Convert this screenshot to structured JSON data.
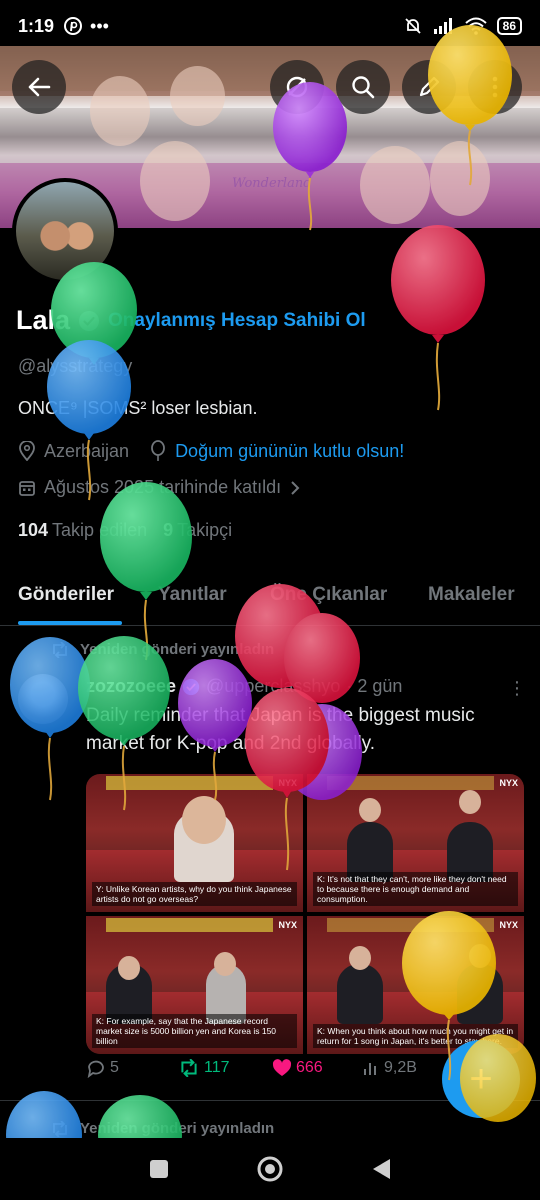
{
  "status_bar": {
    "time": "1:19",
    "battery": "86",
    "icons": [
      "pinterest-icon",
      "more-dots-icon",
      "mute-icon",
      "signal-icon",
      "wifi-icon",
      "battery-icon"
    ]
  },
  "header": {
    "banner_text": "Wonderland",
    "buttons": [
      "back-arrow-icon",
      "slash-eye-icon",
      "search-icon",
      "edit-icon",
      "more-vertical-icon"
    ]
  },
  "profile": {
    "name": "Lala",
    "verify_link": "Onaylanmış Hesap Sahibi Ol",
    "handle": "@alysstrategy",
    "bio": "ONCE⁹ |SOMS²  loser lesbian.",
    "location": "Azerbaijan",
    "birthday": "Doğum gününün kutlu olsun!",
    "joined": "Ağustos 2025 tarihinde katıldı",
    "following_count": "104",
    "following_label": "Takip edilen",
    "followers_count": "9",
    "followers_label": "Takipçi"
  },
  "tabs": [
    {
      "label": "Gönderiler",
      "active": true
    },
    {
      "label": "Yanıtlar",
      "active": false
    },
    {
      "label": "Öne Çıkanlar",
      "active": false
    },
    {
      "label": "Makaleler",
      "active": false
    }
  ],
  "tweet": {
    "repost_label": "Yeniden gönderi yayınladın",
    "author_name": "zozozoeee",
    "author_handle": "@upperclasshyo",
    "time": "· 2 gün",
    "text": "Daily reminder that Japan is the biggest music market for K-pop and 2nd globally.",
    "media": [
      {
        "caption": "Y: Unlike Korean artists, why do you think Japanese artists do not go overseas?",
        "badge": "NYX"
      },
      {
        "caption": "K: It's not that they can't, more like they don't need to because there is enough demand and consumption.",
        "badge": "NYX"
      },
      {
        "caption": "K: For example, say that the Japanese record market size is 5000 billion yen and Korea is 150 billion",
        "badge": "NYX"
      },
      {
        "caption": "K: When you think about how much you might get in return for 1 song in Japan, it's better to stay here.",
        "badge": "NYX"
      }
    ],
    "replies": "5",
    "reposts": "117",
    "likes": "666",
    "views": "9,2B"
  },
  "next_repost_label": "Yeniden gönderi yayınladın",
  "fab_label": "+",
  "colors": {
    "accent": "#1d9bf0",
    "repost": "#00ba7c",
    "like": "#f91880",
    "muted": "#71767b",
    "balloon_colors": [
      "#9b30d9",
      "#f2c11b",
      "#e8264a",
      "#22c06b",
      "#2a8ee8"
    ]
  }
}
